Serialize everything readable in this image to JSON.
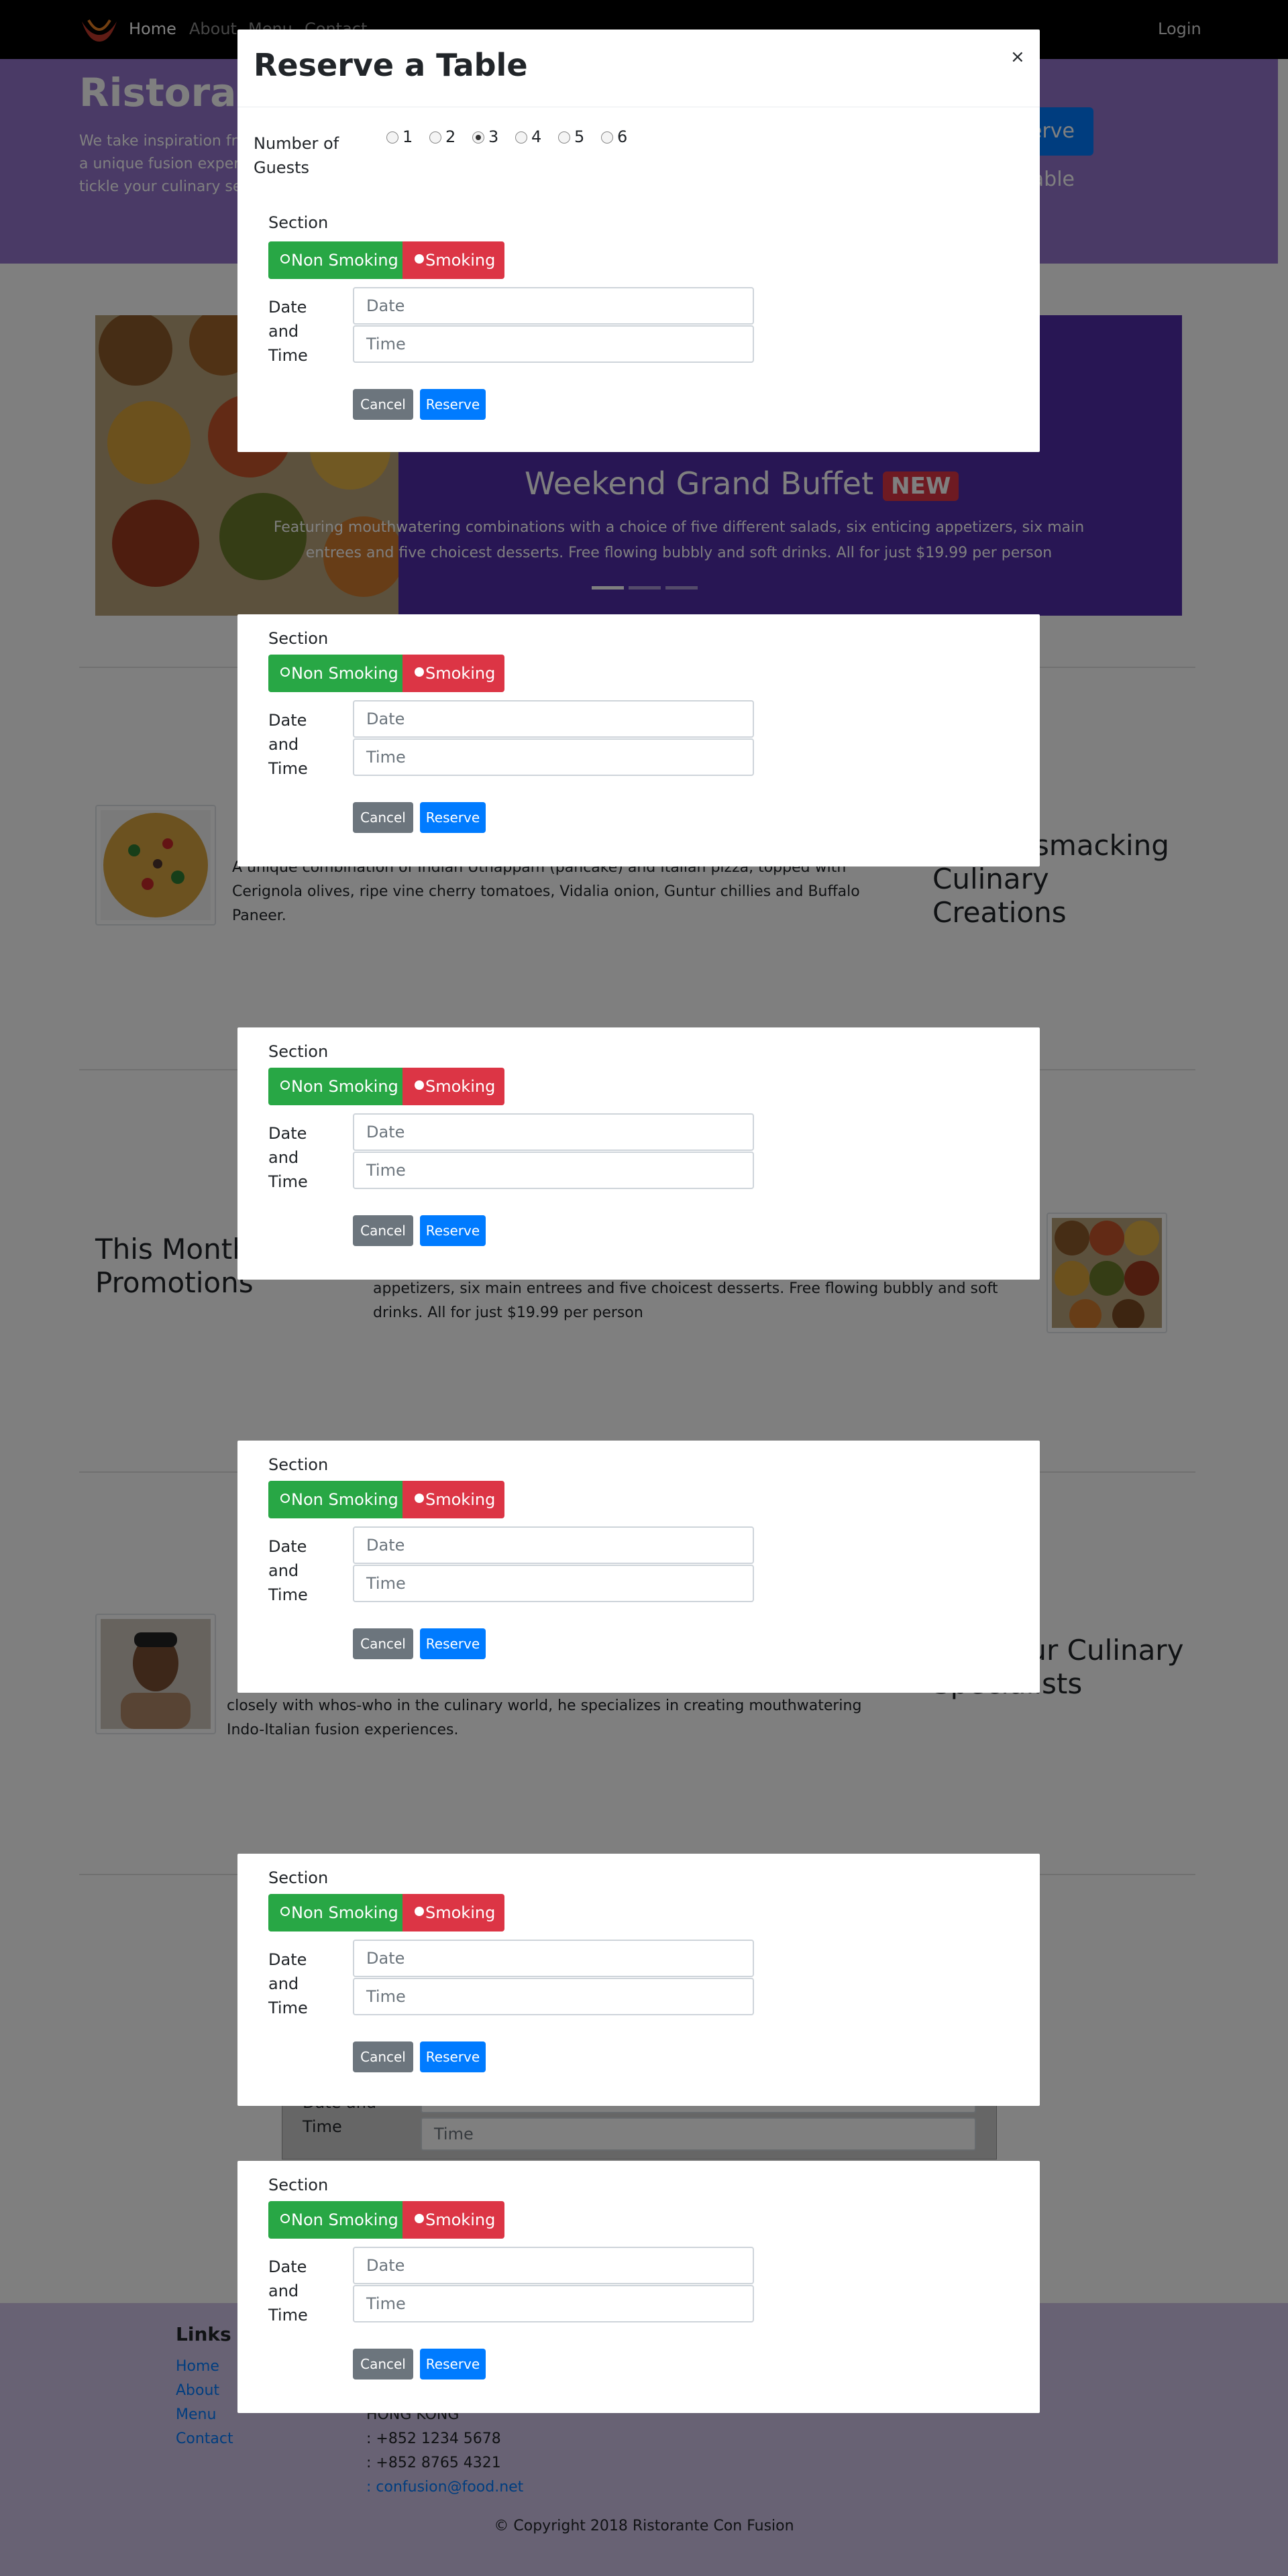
{
  "navbar": {
    "links": [
      "Home",
      "About",
      "Menu",
      "Contact"
    ],
    "login": "Login"
  },
  "jumbotron": {
    "title": "Ristorante Con Fusion",
    "text": "We take inspiration from the World's best cuisines, and create a unique fusion experience. Our lipsmacking creations will tickle your culinary senses!",
    "reserve_button": "Reserve Table"
  },
  "carousel": {
    "title": "Weekend Grand Buffet",
    "badge": "NEW",
    "text": "Featuring mouthwatering combinations with a choice of five different salads, six enticing appetizers, six main entrees and five choicest desserts. Free flowing bubbly and soft drinks. All for just $19.99 per person"
  },
  "featured": {
    "dish_text": "A unique combination of Indian Uthappam (pancake) and Italian pizza, topped with Cerignola olives, ripe vine cherry tomatoes, Vidalia onion, Guntur chillies and Buffalo Paneer.",
    "side_heading": "Our Lipsmacking Culinary Creations"
  },
  "promotions": {
    "heading": "This Month's Promotions",
    "text": "appetizers, six main entrees and five choicest desserts. Free flowing bubbly and soft drinks. All for just $19.99 per person"
  },
  "chef": {
    "text": "closely with whos-who in the culinary world, he specializes in creating mouthwatering Indo-Italian fusion experiences.",
    "side_heading": "Meet our Culinary Specialists"
  },
  "under_form": {
    "label": "Date and Time",
    "date": "Date",
    "time": "Time"
  },
  "footer": {
    "links_heading": "Links",
    "links": [
      "Home",
      "About",
      "Menu",
      "Contact"
    ],
    "address": [
      "HONG KONG",
      ": +852 1234 5678",
      ": +852 8765 4321",
      ": confusion@food.net"
    ],
    "copyright": "© Copyright 2018 Ristorante Con Fusion"
  },
  "modal": {
    "title": "Reserve a Table",
    "close": "×",
    "guests_label": "Number of Guests",
    "guest_options": [
      "1",
      "2",
      "3",
      "4",
      "5",
      "6"
    ],
    "guests_selected": "3",
    "section_label": "Section",
    "non_smoking": "Non Smoking",
    "smoking": "Smoking",
    "datetime_label": "Date and Time",
    "date_placeholder": "Date",
    "time_placeholder": "Time",
    "cancel": "Cancel",
    "reserve": "Reserve"
  },
  "colors": {
    "navbar": "#000000",
    "jumbotron": "#9575cd",
    "carousel": "#512da8",
    "footer": "#d1c4e9",
    "non_smoking": "#28a745",
    "smoking": "#dc3545",
    "primary": "#007bff",
    "secondary": "#6c757d"
  }
}
